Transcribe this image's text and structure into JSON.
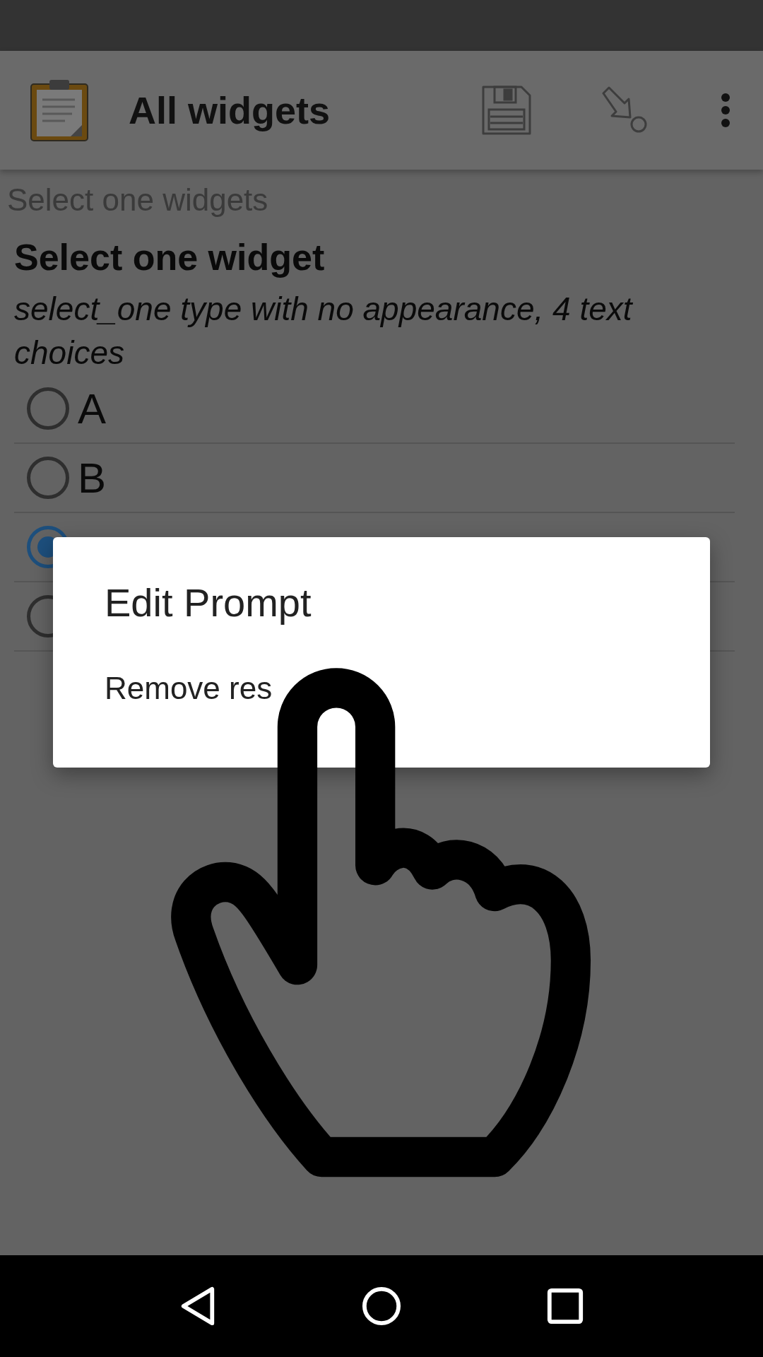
{
  "app_bar": {
    "title": "All widgets"
  },
  "form": {
    "group_label": "Select one widgets",
    "question": "Select one widget",
    "hint": "select_one type with no appearance, 4 text choices",
    "choices": [
      {
        "label": "A",
        "selected": false
      },
      {
        "label": "B",
        "selected": false
      },
      {
        "selected": true
      },
      {
        "selected": false
      }
    ]
  },
  "dialog": {
    "title": "Edit Prompt",
    "items": [
      "Remove res"
    ]
  }
}
